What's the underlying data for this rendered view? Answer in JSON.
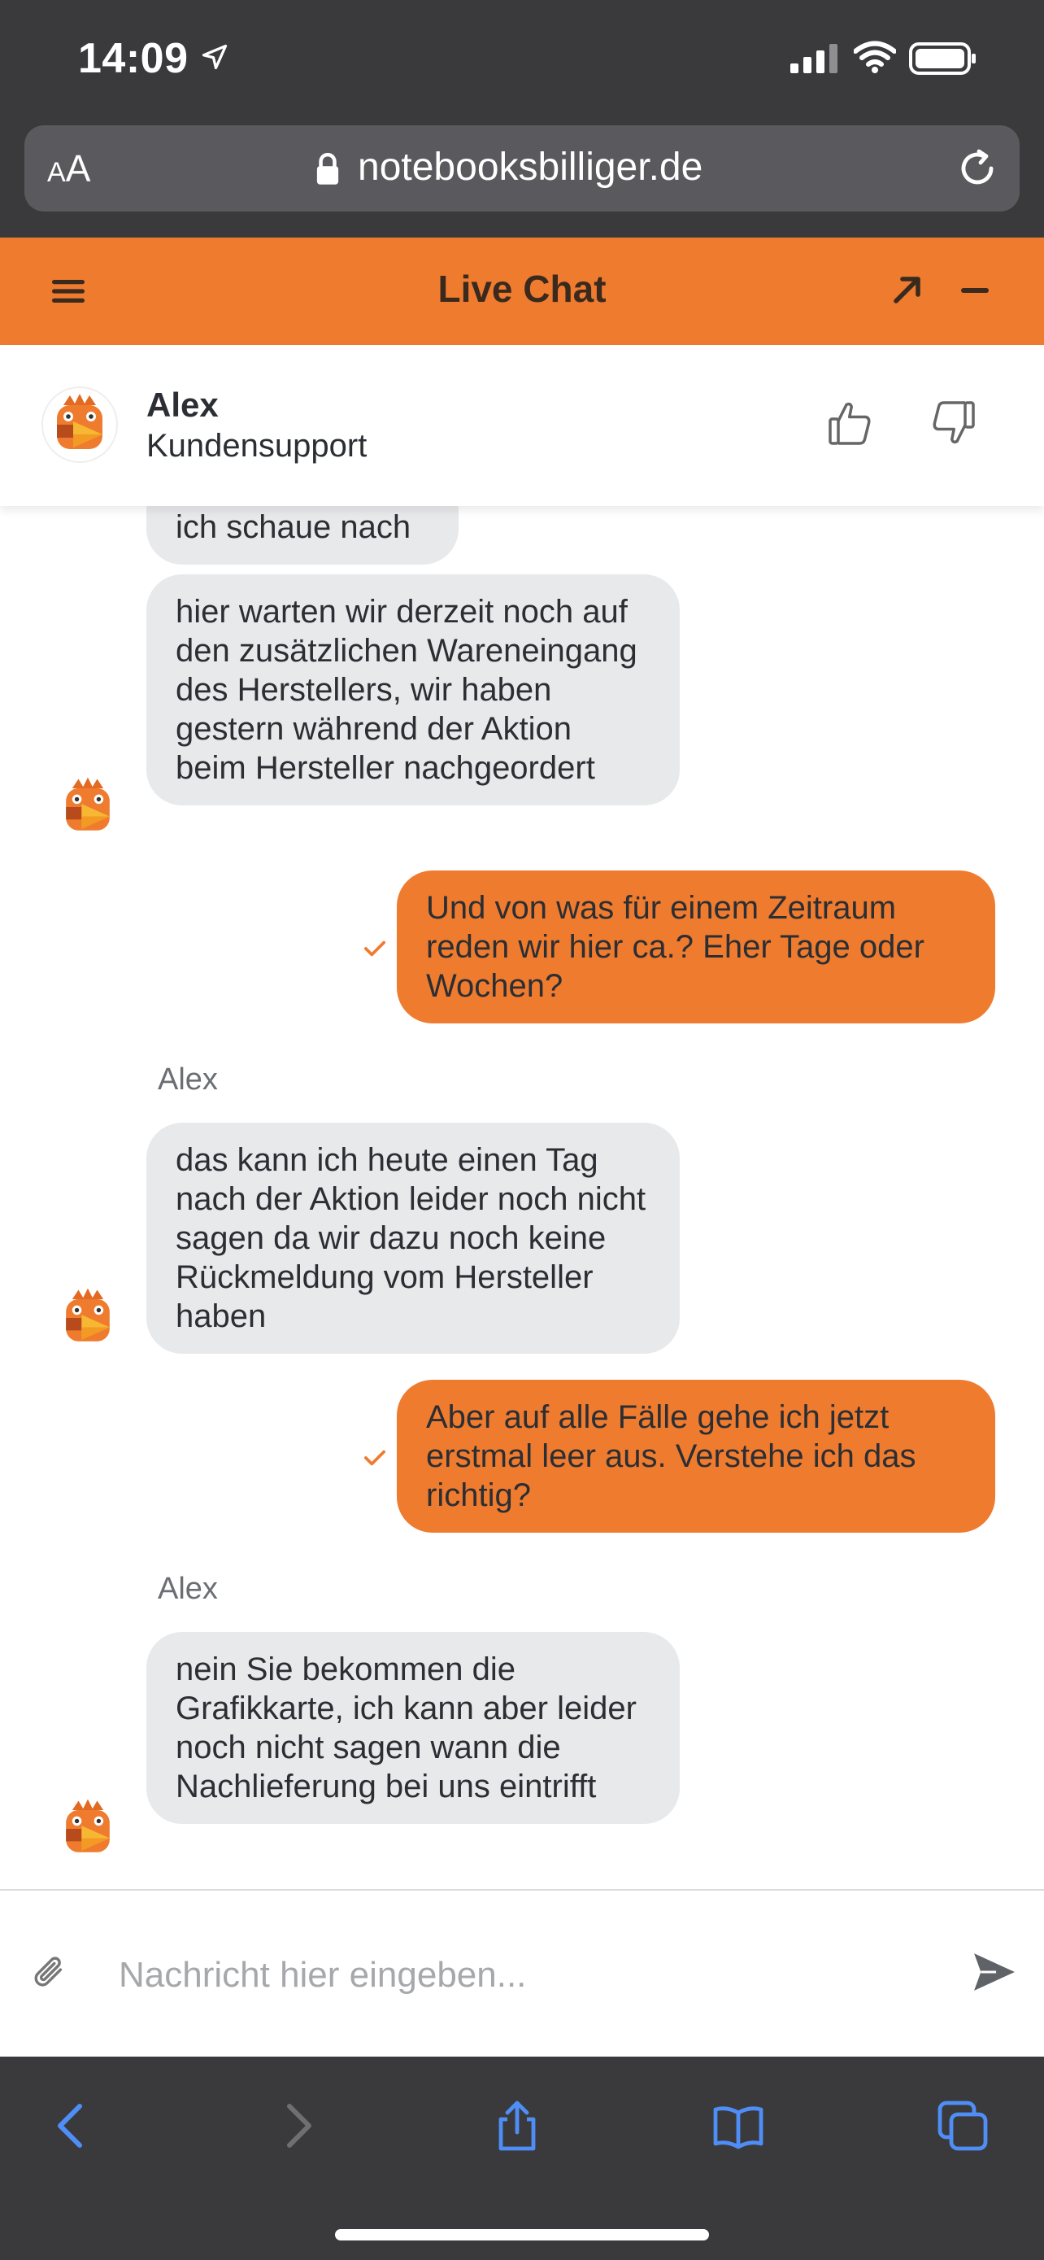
{
  "status_bar": {
    "time": "14:09"
  },
  "browser": {
    "text_size_label_small": "A",
    "text_size_label_large": "A",
    "url": "notebooksbilliger.de"
  },
  "chat_header": {
    "title": "Live Chat"
  },
  "agent": {
    "name": "Alex",
    "role": "Kundensupport"
  },
  "messages": [
    {
      "from": "agent",
      "text": "ich schaue nach"
    },
    {
      "from": "agent",
      "text": "hier warten wir derzeit noch auf den zusätzlichen Wareneingang des Herstellers, wir haben gestern während der Aktion beim Hersteller nachgeordert"
    },
    {
      "from": "user",
      "text": "Und von was für einem Zeitraum reden wir hier ca.? Eher Tage oder Wochen?"
    },
    {
      "from": "agent",
      "sender": "Alex",
      "text": "das kann ich heute einen Tag nach der Aktion leider noch nicht sagen da wir dazu noch keine Rückmeldung vom Hersteller haben"
    },
    {
      "from": "user",
      "text": "Aber auf alle Fälle gehe ich jetzt erstmal leer aus. Verstehe ich das richtig?"
    },
    {
      "from": "agent",
      "sender": "Alex",
      "text": "nein Sie bekommen die Grafikkarte, ich kann aber leider noch nicht sagen wann die Nachlieferung bei uns eintrifft"
    }
  ],
  "composer": {
    "placeholder": "Nachricht hier eingeben..."
  },
  "colors": {
    "accent": "#ef7b2f",
    "agent_bubble": "#e8e9eb",
    "chrome": "#3a3a3c",
    "ios_blue": "#4f8ef7"
  }
}
